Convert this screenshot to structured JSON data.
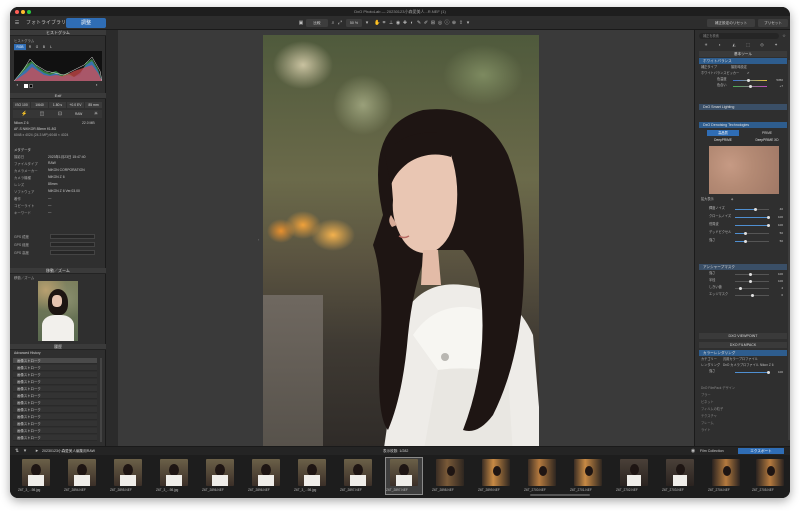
{
  "window": {
    "title": "DxO PhotoLab — 20230123小森愛美人...R.NEF (1)",
    "traffic_colors": [
      "#ff5f57",
      "#febc2e",
      "#28c840"
    ]
  },
  "toolbar": {
    "tab_library": "フォトライブラリ",
    "tab_customize": "調整",
    "compare_label": "比較",
    "zoom_label": "50 %",
    "reset_label": "補正設定のリセット",
    "preset_label": "プリセット"
  },
  "left": {
    "histogram": {
      "header": "ヒストグラム",
      "subtitle": "ヒストグラム",
      "channels": [
        "RGB",
        "R",
        "G",
        "B",
        "L"
      ]
    },
    "exif": {
      "header": "Exif",
      "cells": [
        "ISO 100",
        "1/640",
        "1.80 s",
        "+0.0 EV",
        "85 mm"
      ],
      "camera": "Nikon Z 6",
      "size": "22.0 MB",
      "lens": "AF-S NIKKOR 85mm f/1.8G",
      "dims": "6048 x 4024 (24.3 MP) 6048 × 4024"
    },
    "meta": {
      "header": "メタデータ",
      "rows": [
        {
          "label": "撮影日",
          "value": "2023年1月23日 15:47:40"
        },
        {
          "label": "ファイルタイプ",
          "value": "RAW"
        },
        {
          "label": "カメラメーカー",
          "value": "NIKON CORPORATION"
        },
        {
          "label": "カメラ機種",
          "value": "NIKON Z 6"
        },
        {
          "label": "レンズ",
          "value": "85mm"
        },
        {
          "label": "ソフトウェア",
          "value": "NIKON Z 6 Ver.03.00"
        },
        {
          "label": "著作",
          "value": "—"
        },
        {
          "label": "コピーライト",
          "value": "—"
        },
        {
          "label": "キーワード",
          "value": "—"
        }
      ],
      "gps": [
        "GPS 緯度",
        "GPS 経度",
        "GPS 高度"
      ]
    },
    "nav": {
      "header": "移動／ズーム",
      "subtitle": "移動／ズーム"
    },
    "history": {
      "header": "履歴",
      "subtitle": "Advanced History",
      "items": [
        "画像ストローク",
        "画像ストローク",
        "画像ストローク",
        "画像ストローク",
        "画像ストローク",
        "画像ストローク",
        "画像ストローク",
        "画像ストローク",
        "画像ストローク",
        "画像ストローク",
        "画像ストローク",
        "画像ストローク"
      ]
    }
  },
  "right": {
    "search_placeholder": "補正を検索",
    "section_basic": "基本ツール",
    "wb": {
      "header": "ホワイトバランス",
      "mode_label": "補正タイプ",
      "mode_value": "撮影時設定",
      "picker_label": "ホワイトバランスピッカー",
      "temp_label": "色温度",
      "temp_value": "5350",
      "tint_label": "色合い",
      "tint_value": "+7"
    },
    "smart_lighting": "DxO Smart Lighting",
    "denoise": {
      "header": "DxO Denoising Technologies",
      "mode_active": "高品質",
      "mode_other": "PRIME",
      "mode_deep": "DeepPRIME",
      "mode_deepxd": "DeepPRIME XD",
      "sliders": [
        {
          "label": "輝度ノイズ",
          "value": "40",
          "pct": 0.6
        },
        {
          "label": "クロームノイズ",
          "value": "100",
          "pct": 1.0
        },
        {
          "label": "低周波",
          "value": "100",
          "pct": 1.0
        },
        {
          "label": "デッドピクセル",
          "value": "50",
          "pct": 0.3
        },
        {
          "label": "強さ",
          "value": "50",
          "pct": 0.3
        }
      ],
      "highlight_label": "拡大表示"
    },
    "sharpen": {
      "header": "アンシャープマスク",
      "rows": [
        {
          "label": "強さ",
          "value": "100",
          "pct": 0.45
        },
        {
          "label": "半径",
          "value": "100",
          "pct": 0.45
        },
        {
          "label": "しきい値",
          "value": "4",
          "pct": 0.1
        },
        {
          "label": "エッジマスク",
          "value": "0",
          "pct": 0.5
        }
      ]
    },
    "viewpoint": "DXO VIEWPOINT",
    "filmpack": "DXO FILMPACK",
    "color_render": {
      "header": "カラーレンダリング",
      "category_label": "カテゴリー",
      "category_value": "汎用カラープロファイル",
      "render_label": "レンダリング",
      "render_value": "DxO カメラプロファイル Nikon Z 6",
      "strength_label": "強さ",
      "strength_value": "100"
    },
    "more_rows": [
      "DxO FilmPack デザイン",
      "ブラー",
      "ビネット",
      "フィルムの粒子",
      "テクスチャ",
      "フレーム",
      "ライト"
    ]
  },
  "filmbar": {
    "folder": "20230123小森愛美人編集用RAW",
    "count": "表示枚数: 1/282",
    "export_label": "エクスポート"
  },
  "thumbs": [
    {
      "name": "Z6T_3_...98.jpg"
    },
    {
      "name": "Z6T_2894.NEF"
    },
    {
      "name": "Z6T_2895.NEF"
    },
    {
      "name": "Z6T_3_...98.jpg"
    },
    {
      "name": "Z6T_2896.NEF"
    },
    {
      "name": "Z6T_2896.NEF"
    },
    {
      "name": "Z6T_3_...98.jpg"
    },
    {
      "name": "Z6T_2897.NEF"
    },
    {
      "name": "Z6T_2897.NEF"
    },
    {
      "name": "Z6T_2898.NEF"
    },
    {
      "name": "Z6T_2899.NEF"
    },
    {
      "name": "Z6T_2700.NEF"
    },
    {
      "name": "Z6T_2701.NEF"
    },
    {
      "name": "Z6T_2702.NEF"
    },
    {
      "name": "Z6T_2703.NEF"
    },
    {
      "name": "Z6T_2704.NEF"
    },
    {
      "name": "Z6T_2705.NEF"
    }
  ]
}
